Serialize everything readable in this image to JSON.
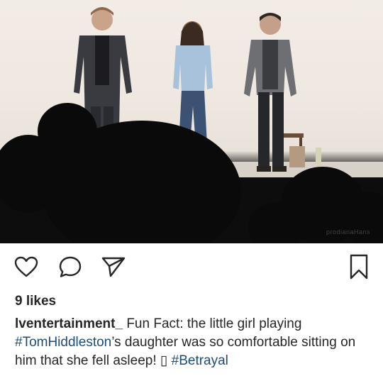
{
  "photo": {
    "alt_subject": "stage curtain call",
    "watermark": "prodianaHans"
  },
  "actions": {
    "like_icon": "heart-icon",
    "comment_icon": "comment-bubble-icon",
    "share_icon": "paper-plane-icon",
    "save_icon": "bookmark-icon"
  },
  "likes": {
    "text": "9 likes"
  },
  "caption": {
    "username": "lventertainment_",
    "text_1": " Fun Fact: the little girl playing ",
    "tag_1": "#TomHiddleston",
    "text_2": "’s daughter was so comfortable sitting on him that she fell asleep! ",
    "emoji": "▯",
    "text_3": " ",
    "tag_2": "#Betrayal"
  },
  "colors": {
    "text": "#262626",
    "hashtag": "#1b4d7a",
    "icon": "#262626",
    "background": "#ffffff"
  }
}
